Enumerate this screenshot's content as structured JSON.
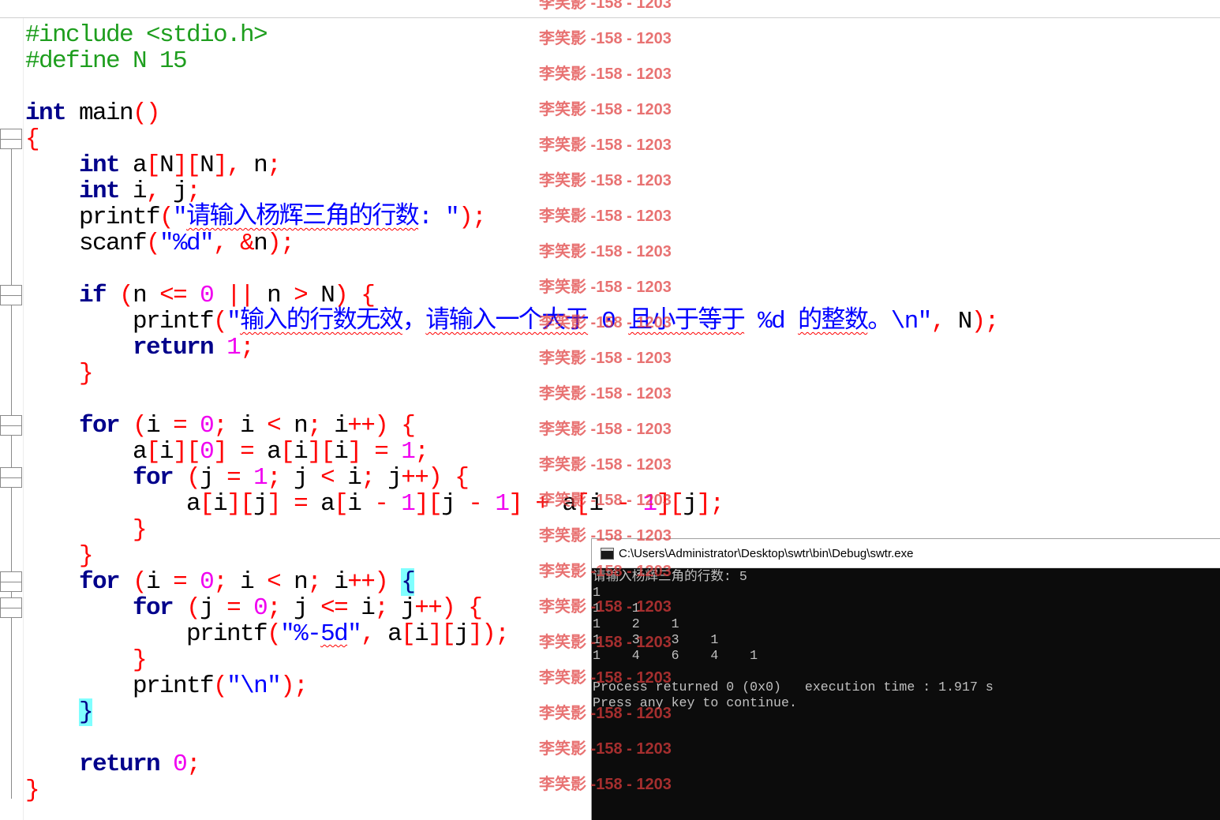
{
  "colors": {
    "preprocessor": "#1e9e1e",
    "keyword": "#00008b",
    "string": "#0000ff",
    "number": "#f000f0",
    "operator": "#ff0000",
    "brace_highlight": "#80ffff",
    "console_bg": "#0c0c0c",
    "console_text": "#c0c0c0",
    "watermark": "#e03c3c"
  },
  "code": {
    "lines": [
      [
        {
          "pp": "#include <stdio.h>"
        }
      ],
      [
        {
          "pp": "#define N 15"
        }
      ],
      [],
      [
        {
          "kw": "int"
        },
        {
          "id": " main"
        },
        {
          "op": "()"
        }
      ],
      [
        {
          "op": "{"
        }
      ],
      [
        {
          "id": "    "
        },
        {
          "kw": "int"
        },
        {
          "id": " a"
        },
        {
          "op": "["
        },
        {
          "id": "N"
        },
        {
          "op": "]["
        },
        {
          "id": "N"
        },
        {
          "op": "],"
        },
        {
          "id": " n"
        },
        {
          "op": ";"
        }
      ],
      [
        {
          "id": "    "
        },
        {
          "kw": "int"
        },
        {
          "id": " i"
        },
        {
          "op": ","
        },
        {
          "id": " j"
        },
        {
          "op": ";"
        }
      ],
      [
        {
          "id": "    printf"
        },
        {
          "op": "("
        },
        {
          "str": "\""
        },
        {
          "sq": "请输入杨辉三角的行数"
        },
        {
          "str": ": \""
        },
        {
          "op": ");"
        }
      ],
      [
        {
          "id": "    scanf"
        },
        {
          "op": "("
        },
        {
          "str": "\"%d\""
        },
        {
          "op": ","
        },
        {
          "id": " "
        },
        {
          "op": "&"
        },
        {
          "id": "n"
        },
        {
          "op": ");"
        }
      ],
      [],
      [
        {
          "id": "    "
        },
        {
          "kw": "if"
        },
        {
          "id": " "
        },
        {
          "op": "("
        },
        {
          "id": "n "
        },
        {
          "op": "<="
        },
        {
          "id": " "
        },
        {
          "num": "0"
        },
        {
          "id": " "
        },
        {
          "op": "||"
        },
        {
          "id": " n "
        },
        {
          "op": ">"
        },
        {
          "id": " N"
        },
        {
          "op": ")"
        },
        {
          "id": " "
        },
        {
          "op": "{"
        }
      ],
      [
        {
          "id": "        printf"
        },
        {
          "op": "("
        },
        {
          "str": "\""
        },
        {
          "sq": "输入的行数无效"
        },
        {
          "str": "，"
        },
        {
          "sq": "请输入一个大于"
        },
        {
          "str": " 0 "
        },
        {
          "sq": "且小于等于"
        },
        {
          "str": " %d "
        },
        {
          "sq": "的整数"
        },
        {
          "str": "。\\n\""
        },
        {
          "op": ","
        },
        {
          "id": " N"
        },
        {
          "op": ");"
        }
      ],
      [
        {
          "id": "        "
        },
        {
          "kw": "return"
        },
        {
          "id": " "
        },
        {
          "num": "1"
        },
        {
          "op": ";"
        }
      ],
      [
        {
          "id": "    "
        },
        {
          "op": "}"
        }
      ],
      [],
      [
        {
          "id": "    "
        },
        {
          "kw": "for"
        },
        {
          "id": " "
        },
        {
          "op": "("
        },
        {
          "id": "i "
        },
        {
          "op": "="
        },
        {
          "id": " "
        },
        {
          "num": "0"
        },
        {
          "op": ";"
        },
        {
          "id": " i "
        },
        {
          "op": "<"
        },
        {
          "id": " n"
        },
        {
          "op": ";"
        },
        {
          "id": " i"
        },
        {
          "op": "++)"
        },
        {
          "id": " "
        },
        {
          "op": "{"
        }
      ],
      [
        {
          "id": "        a"
        },
        {
          "op": "["
        },
        {
          "id": "i"
        },
        {
          "op": "]["
        },
        {
          "num": "0"
        },
        {
          "op": "]"
        },
        {
          "id": " "
        },
        {
          "op": "="
        },
        {
          "id": " a"
        },
        {
          "op": "["
        },
        {
          "id": "i"
        },
        {
          "op": "]["
        },
        {
          "id": "i"
        },
        {
          "op": "]"
        },
        {
          "id": " "
        },
        {
          "op": "="
        },
        {
          "id": " "
        },
        {
          "num": "1"
        },
        {
          "op": ";"
        }
      ],
      [
        {
          "id": "        "
        },
        {
          "kw": "for"
        },
        {
          "id": " "
        },
        {
          "op": "("
        },
        {
          "id": "j "
        },
        {
          "op": "="
        },
        {
          "id": " "
        },
        {
          "num": "1"
        },
        {
          "op": ";"
        },
        {
          "id": " j "
        },
        {
          "op": "<"
        },
        {
          "id": " i"
        },
        {
          "op": ";"
        },
        {
          "id": " j"
        },
        {
          "op": "++)"
        },
        {
          "id": " "
        },
        {
          "op": "{"
        }
      ],
      [
        {
          "id": "            a"
        },
        {
          "op": "["
        },
        {
          "id": "i"
        },
        {
          "op": "]["
        },
        {
          "id": "j"
        },
        {
          "op": "]"
        },
        {
          "id": " "
        },
        {
          "op": "="
        },
        {
          "id": " a"
        },
        {
          "op": "["
        },
        {
          "id": "i "
        },
        {
          "op": "-"
        },
        {
          "id": " "
        },
        {
          "num": "1"
        },
        {
          "op": "]["
        },
        {
          "id": "j "
        },
        {
          "op": "-"
        },
        {
          "id": " "
        },
        {
          "num": "1"
        },
        {
          "op": "]"
        },
        {
          "id": " "
        },
        {
          "op": "+"
        },
        {
          "id": " a"
        },
        {
          "op": "["
        },
        {
          "id": "i "
        },
        {
          "op": "-"
        },
        {
          "id": " "
        },
        {
          "num": "1"
        },
        {
          "op": "]["
        },
        {
          "id": "j"
        },
        {
          "op": "];"
        }
      ],
      [
        {
          "id": "        "
        },
        {
          "op": "}"
        }
      ],
      [
        {
          "id": "    "
        },
        {
          "op": "}"
        }
      ],
      [
        {
          "id": "    "
        },
        {
          "kw": "for"
        },
        {
          "id": " "
        },
        {
          "op": "("
        },
        {
          "id": "i "
        },
        {
          "op": "="
        },
        {
          "id": " "
        },
        {
          "num": "0"
        },
        {
          "op": ";"
        },
        {
          "id": " i "
        },
        {
          "op": "<"
        },
        {
          "id": " n"
        },
        {
          "op": ";"
        },
        {
          "id": " i"
        },
        {
          "op": "++)"
        },
        {
          "id": " "
        },
        {
          "hl": "{"
        }
      ],
      [
        {
          "id": "        "
        },
        {
          "kw": "for"
        },
        {
          "id": " "
        },
        {
          "op": "("
        },
        {
          "id": "j "
        },
        {
          "op": "="
        },
        {
          "id": " "
        },
        {
          "num": "0"
        },
        {
          "op": ";"
        },
        {
          "id": " j "
        },
        {
          "op": "<="
        },
        {
          "id": " i"
        },
        {
          "op": ";"
        },
        {
          "id": " j"
        },
        {
          "op": "++)"
        },
        {
          "id": " "
        },
        {
          "op": "{"
        }
      ],
      [
        {
          "id": "            printf"
        },
        {
          "op": "("
        },
        {
          "str": "\"%-"
        },
        {
          "sq": "5d"
        },
        {
          "str": "\""
        },
        {
          "op": ","
        },
        {
          "id": " a"
        },
        {
          "op": "["
        },
        {
          "id": "i"
        },
        {
          "op": "]["
        },
        {
          "id": "j"
        },
        {
          "op": "])"
        },
        {
          "op": ";"
        }
      ],
      [
        {
          "id": "        "
        },
        {
          "op": "}"
        }
      ],
      [
        {
          "id": "        printf"
        },
        {
          "op": "("
        },
        {
          "str": "\"\\n\""
        },
        {
          "op": ");"
        }
      ],
      [
        {
          "id": "    "
        },
        {
          "hl": "}"
        }
      ],
      [],
      [
        {
          "id": "    "
        },
        {
          "kw": "return"
        },
        {
          "id": " "
        },
        {
          "num": "0"
        },
        {
          "op": ";"
        }
      ],
      [
        {
          "op": "}"
        }
      ]
    ]
  },
  "console": {
    "title": "C:\\Users\\Administrator\\Desktop\\swtr\\bin\\Debug\\swtr.exe",
    "icon": "console-window-icon",
    "lines": [
      "请输入杨辉三角的行数: 5",
      "1",
      "1    1",
      "1    2    1",
      "1    3    3    1",
      "1    4    6    4    1",
      "",
      "Process returned 0 (0x0)   execution time : 1.917 s",
      "Press any key to continue."
    ]
  },
  "watermark": {
    "text": "李笑影 -158 - 1203"
  }
}
